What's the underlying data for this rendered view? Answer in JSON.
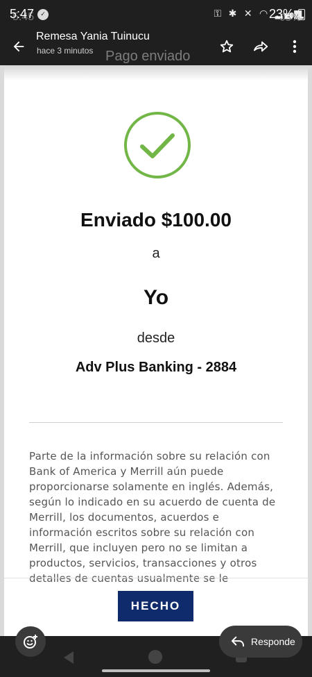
{
  "status_bar": {
    "time": "5:47",
    "time_ghost": "5:45",
    "battery": "23%",
    "battery_ghost": "03%"
  },
  "app_bar": {
    "title": "Remesa Yania Tuinucu",
    "subtitle": "hace 3 minutos",
    "ghost_title": "Pago enviado"
  },
  "payment": {
    "sent_amount": "Enviado $100.00",
    "connector_a": "a",
    "recipient": "Yo",
    "connector_from": "desde",
    "account": "Adv Plus Banking - 2884",
    "disclaimer": "Parte de la información sobre su relación con Bank of America y Merrill aún puede proporcionarse solamente en inglés. Además, según lo indicado en su acuerdo de cuenta de Merrill, los documentos, acuerdos e información escritos sobre su relación con Merrill, que incluyen pero no se limitan a productos, servicios, transacciones y otros detalles de cuentas usualmente se le",
    "done_label": "HECHO"
  },
  "bottom_actions": {
    "reply_label": "Responde"
  },
  "icons": {
    "back": "arrow-left-icon",
    "star": "star-icon",
    "forward": "forward-icon",
    "more": "more-vert-icon",
    "success": "checkmark-circle-icon",
    "emoji": "emoji-add-icon",
    "reply": "reply-icon"
  },
  "colors": {
    "success_green": "#72b648",
    "button_navy": "#0f2b6b",
    "dark_bar": "#1f1f1f"
  }
}
